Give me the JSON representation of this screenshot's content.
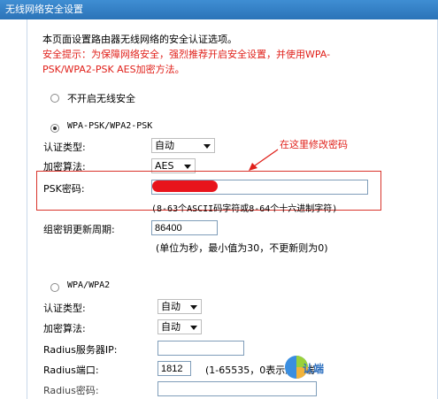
{
  "header": {
    "title": "无线网络安全设置"
  },
  "intro": {
    "line1": "本页面设置路由器无线网络的安全认证选项。",
    "tip_line1": "安全提示：为保障网络安全，强烈推荐开启安全设置，并使用WPA-",
    "tip_line2": "PSK/WPA2-PSK AES加密方法。"
  },
  "options": {
    "disable": "不开启无线安全",
    "wpa_psk": "WPA-PSK/WPA2-PSK",
    "wpa": "WPA/WPA2"
  },
  "psk": {
    "auth_label": "认证类型:",
    "auth_value": "自动",
    "enc_label": "加密算法:",
    "enc_value": "AES",
    "key_label": "PSK密码:",
    "key_value": "",
    "key_hint": "(8-63个ASCII码字符或8-64个十六进制字符)",
    "group_label": "组密钥更新周期:",
    "group_value": "86400",
    "group_hint": "(单位为秒，最小值为30，不更新则为0)"
  },
  "annotation": {
    "text": "在这里修改密码",
    "color": "#e0201a"
  },
  "wpa": {
    "auth_label": "认证类型:",
    "auth_value": "自动",
    "enc_label": "加密算法:",
    "enc_value": "自动",
    "radius_ip_label": "Radius服务器IP:",
    "radius_ip_value": "",
    "radius_port_label": "Radius端口:",
    "radius_port_value": "1812",
    "radius_port_hint": "(1-65535，0表示默认端",
    "radius_pwd_label": "Radius密码:"
  },
  "watermark": {
    "text": "认端",
    "icon": "logo-icon"
  }
}
